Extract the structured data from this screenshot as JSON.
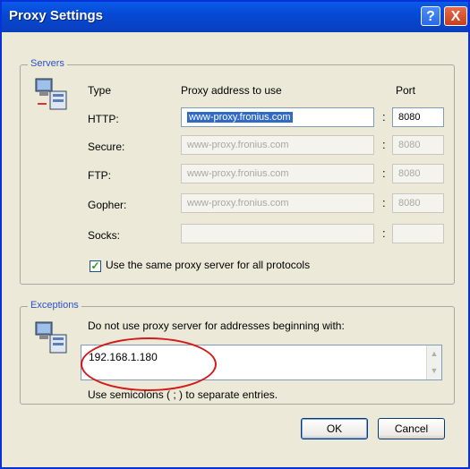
{
  "window": {
    "title": "Proxy Settings",
    "help_glyph": "?",
    "close_glyph": "X"
  },
  "servers": {
    "legend": "Servers",
    "headers": {
      "type": "Type",
      "address": "Proxy address to use",
      "port": "Port"
    },
    "rows": [
      {
        "type": "HTTP:",
        "address": "www-proxy.fronius.com",
        "port": "8080"
      },
      {
        "type": "Secure:",
        "address": "www-proxy.fronius.com",
        "port": "8080"
      },
      {
        "type": "FTP:",
        "address": "www-proxy.fronius.com",
        "port": "8080"
      },
      {
        "type": "Gopher:",
        "address": "www-proxy.fronius.com",
        "port": "8080"
      },
      {
        "type": "Socks:",
        "address": "",
        "port": ""
      }
    ],
    "same_proxy_label": "Use the same proxy server for all protocols",
    "same_proxy_checked": true
  },
  "exceptions": {
    "legend": "Exceptions",
    "instruction": "Do not use proxy server for addresses beginning with:",
    "value": "192.168.1.180",
    "hint": "Use semicolons ( ; ) to separate entries."
  },
  "buttons": {
    "ok": "OK",
    "cancel": "Cancel"
  },
  "colors": {
    "title_bar": "#0a5ce8",
    "highlight_circle": "#d11a1a",
    "selection": "#316ac5"
  }
}
